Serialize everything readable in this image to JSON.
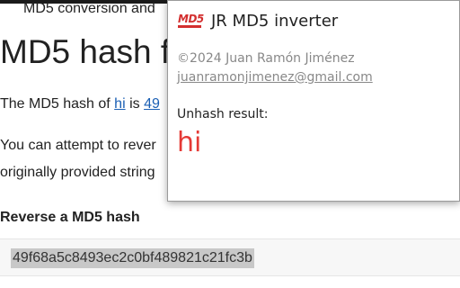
{
  "background_page": {
    "crumb": "MD5 conversion and",
    "title": "MD5 hash f",
    "para1": {
      "prefix": "The MD5 hash of ",
      "link_text": "hi",
      "middle": " is ",
      "hash_link": "49"
    },
    "para2": "You can attempt to rever",
    "para3": "originally provided string",
    "section_heading": "Reverse a MD5 hash",
    "hash_input_value": "49f68a5c8493ec2c0bf489821c21fc3b"
  },
  "popup": {
    "logo_text": "MD5",
    "title": "JR MD5 inverter",
    "copyright": "©2024 Juan Ramón Jiménez",
    "email": "juanramonjimenez@gmail.com",
    "result_label": "Unhash result:",
    "result_value": "hi"
  },
  "colors": {
    "accent_red": "#e53935",
    "logo_red": "#d32f2f",
    "link_blue": "#1a5fb4",
    "muted_gray": "#888888"
  }
}
